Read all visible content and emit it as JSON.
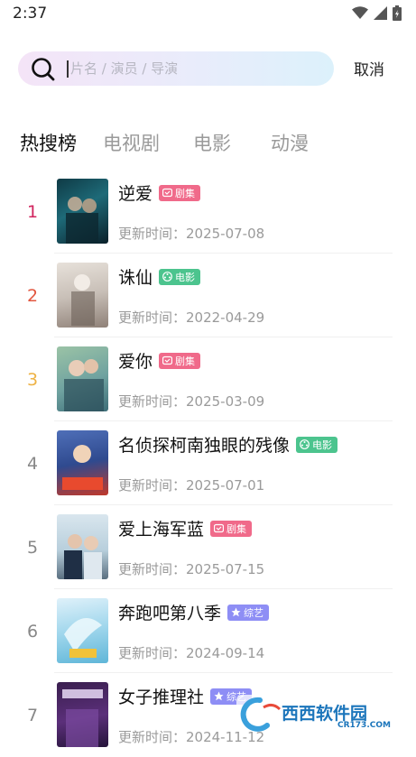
{
  "status_bar": {
    "time": "2:37"
  },
  "search": {
    "placeholder": "片名 / 演员 / 导演",
    "cancel_label": "取消"
  },
  "tabs": [
    {
      "label": "热搜榜",
      "active": true
    },
    {
      "label": "电视剧",
      "active": false
    },
    {
      "label": "电影",
      "active": false
    },
    {
      "label": "动漫",
      "active": false
    }
  ],
  "badge_colors": {
    "剧集": "#f06a8a",
    "电影": "#4cc48e",
    "综艺": "#8e8ef5"
  },
  "rank_colors": {
    "1": "#d1245e",
    "2": "#e2563f",
    "3": "#eeb244",
    "default": "#888888"
  },
  "list": [
    {
      "rank": "1",
      "title": "逆爱",
      "badge": "剧集",
      "updated": "更新时间：2025-07-08"
    },
    {
      "rank": "2",
      "title": "诛仙",
      "badge": "电影",
      "updated": "更新时间：2022-04-29"
    },
    {
      "rank": "3",
      "title": "爱你",
      "badge": "剧集",
      "updated": "更新时间：2025-03-09"
    },
    {
      "rank": "4",
      "title": "名侦探柯南独眼的残像",
      "badge": "电影",
      "updated": "更新时间：2025-07-01"
    },
    {
      "rank": "5",
      "title": "爱上海军蓝",
      "badge": "剧集",
      "updated": "更新时间：2025-07-15"
    },
    {
      "rank": "6",
      "title": "奔跑吧第八季",
      "badge": "综艺",
      "updated": "更新时间：2024-09-14"
    },
    {
      "rank": "7",
      "title": "女子推理社",
      "badge": "综艺",
      "updated": "更新时间：2024-11-12"
    }
  ],
  "watermark": {
    "brand": "西西软件园",
    "url": "CR173.COM"
  }
}
